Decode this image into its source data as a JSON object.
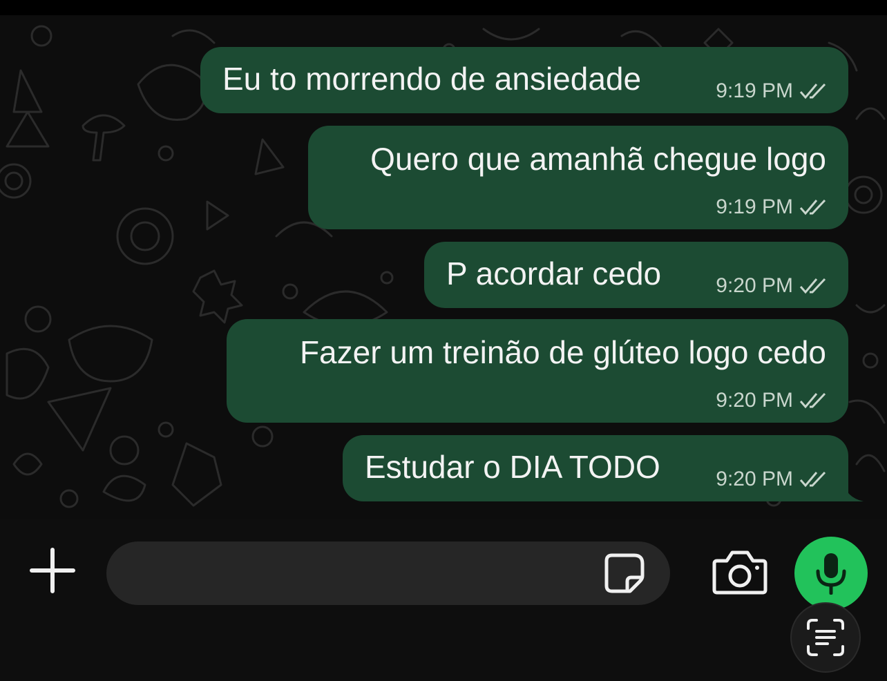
{
  "messages": [
    {
      "text": "Eu to morrendo de ansiedade",
      "time": "9:19 PM",
      "status": "read"
    },
    {
      "text": "Quero que amanhã chegue logo",
      "time": "9:19 PM",
      "status": "read"
    },
    {
      "text": "P acordar cedo",
      "time": "9:20 PM",
      "status": "read"
    },
    {
      "text": "Fazer um treinão de glúteo logo cedo",
      "time": "9:20 PM",
      "status": "read"
    },
    {
      "text": "Estudar o DIA TODO",
      "time": "9:20 PM",
      "status": "read"
    }
  ],
  "composer": {
    "value": "",
    "placeholder": ""
  },
  "icons": {
    "attach": "plus-icon",
    "sticker": "sticker-icon",
    "camera": "camera-icon",
    "mic": "microphone-icon",
    "scan": "text-scan-icon",
    "read_receipt": "double-check-icon"
  },
  "colors": {
    "bubble": "#1c4b33",
    "accent": "#22c25b",
    "background": "#0d0d0d"
  }
}
